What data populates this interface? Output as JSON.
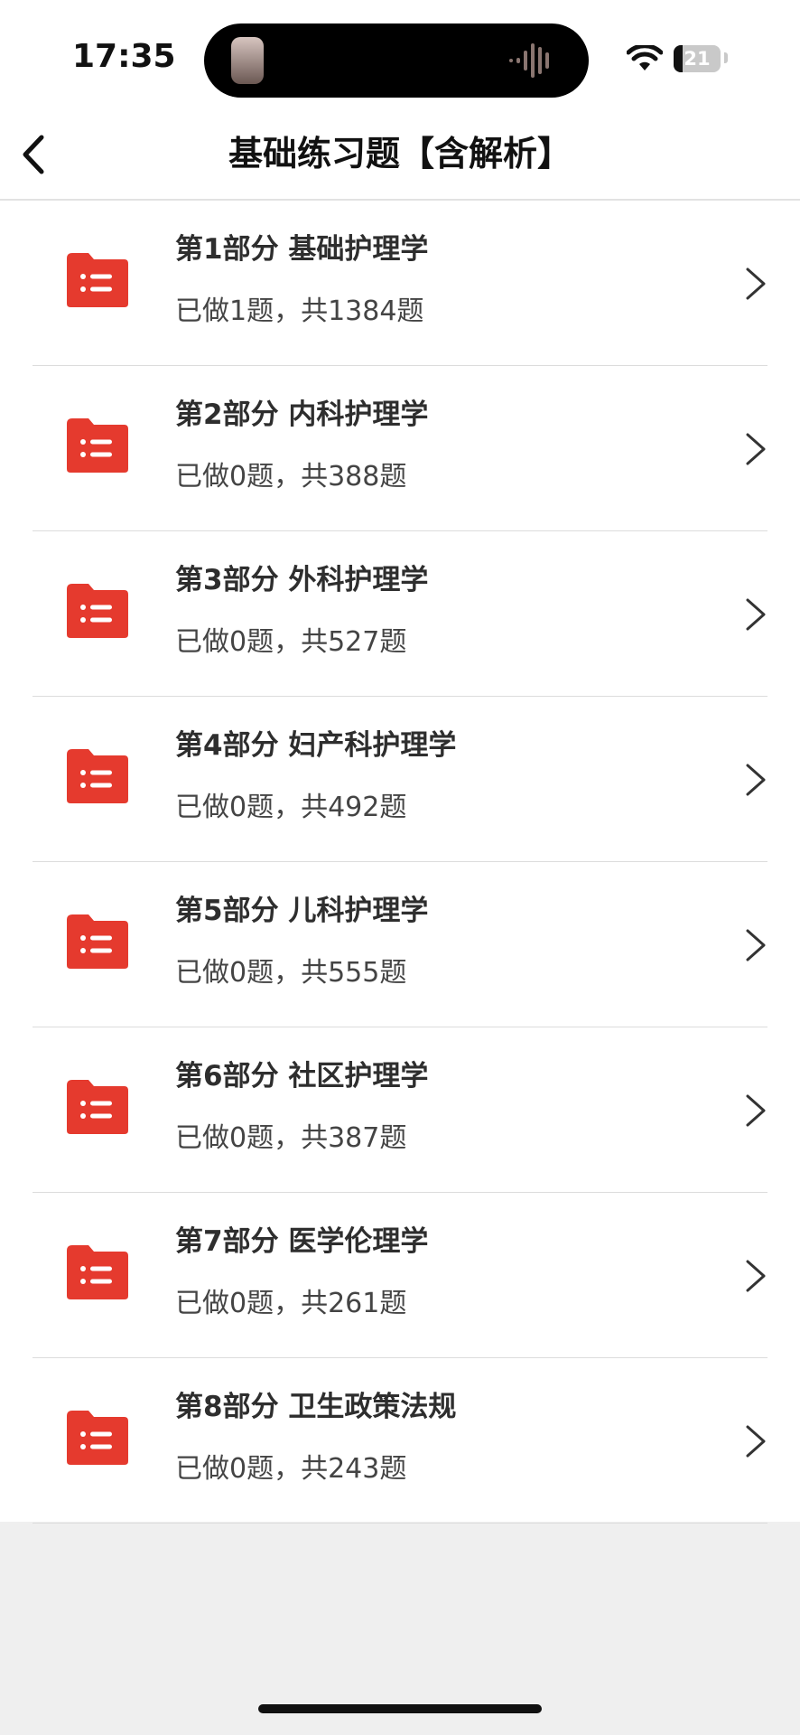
{
  "status": {
    "time": "17:35",
    "battery": "21"
  },
  "nav": {
    "title": "基础练习题【含解析】"
  },
  "items": [
    {
      "title": "第1部分  基础护理学",
      "sub": "已做1题，共1384题"
    },
    {
      "title": "第2部分  内科护理学",
      "sub": "已做0题，共388题"
    },
    {
      "title": "第3部分  外科护理学",
      "sub": "已做0题，共527题"
    },
    {
      "title": "第4部分  妇产科护理学",
      "sub": "已做0题，共492题"
    },
    {
      "title": "第5部分  儿科护理学",
      "sub": "已做0题，共555题"
    },
    {
      "title": "第6部分  社区护理学",
      "sub": "已做0题，共387题"
    },
    {
      "title": "第7部分  医学伦理学",
      "sub": "已做0题，共261题"
    },
    {
      "title": "第8部分  卫生政策法规",
      "sub": "已做0题，共243题"
    }
  ],
  "colors": {
    "accent": "#e53a2e",
    "background": "#efefef"
  },
  "icons": {
    "back": "chevron-left-icon",
    "row": "list-folder-icon",
    "row_arrow": "chevron-right-icon"
  }
}
